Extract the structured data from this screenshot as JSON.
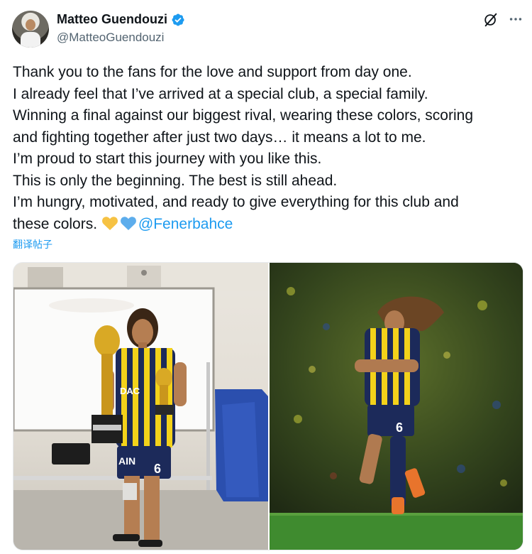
{
  "author": {
    "name": "Matteo Guendouzi",
    "handle": "@MatteoGuendouzi",
    "verified": true
  },
  "header_icons": [
    "grok-icon",
    "more-icon"
  ],
  "tweet": {
    "lines": [
      "Thank you to the fans for the love and support from day one.",
      "I already feel that I’ve arrived at a special club, a special family.",
      "Winning a final against our biggest rival, wearing these colors, scoring",
      "and fighting together after just two days… it means a lot to me.",
      "I’m proud to start this journey with you like this.",
      "This is only the beginning. The best is still ahead.",
      "I’m hungry, motivated, and ready to give everything for this club and"
    ],
    "last_line_text": "these colors.",
    "emojis": [
      "yellow-heart",
      "blue-heart"
    ],
    "mention": "@Fenerbahce"
  },
  "translate_label": "翻译帖子",
  "media": {
    "left": {
      "jersey_text": "DAC",
      "number": "6",
      "shorts_text": "AIN"
    },
    "right": {
      "number": "6"
    }
  },
  "colors": {
    "link": "#1d9bf0",
    "text": "#0f1419",
    "secondary": "#536471",
    "verified": "#1d9bf0",
    "club_yellow": "#f3d21a",
    "club_navy": "#1c2a5a"
  }
}
